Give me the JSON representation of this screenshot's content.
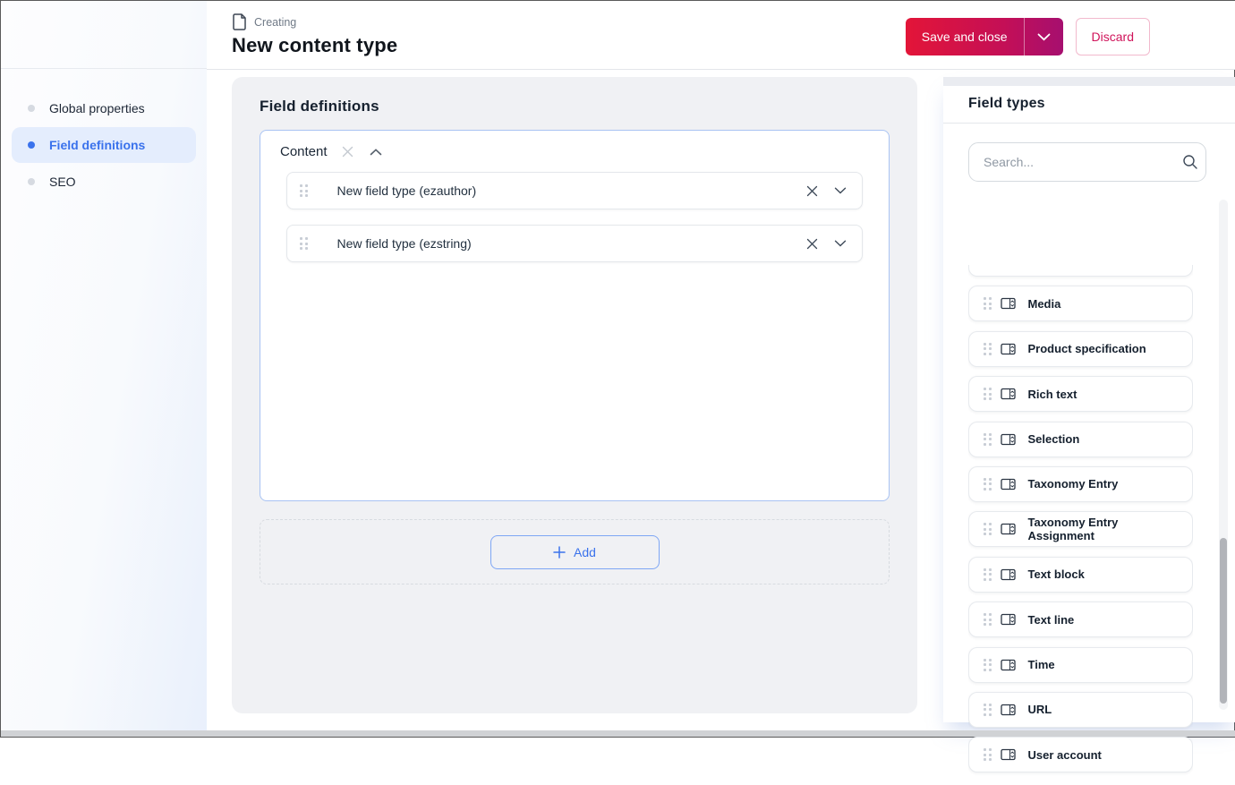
{
  "page": {
    "overline": "Creating",
    "title": "New content type"
  },
  "header": {
    "save_button_label": "Save and close",
    "discard_button_label": "Discard"
  },
  "sidebar": {
    "items": [
      {
        "label": "Global properties",
        "active": false
      },
      {
        "label": "Field definitions",
        "active": true
      },
      {
        "label": "SEO",
        "active": false
      }
    ]
  },
  "main": {
    "section_title": "Field definitions",
    "group": {
      "title": "Content",
      "fields": [
        {
          "label": "New field type (ezauthor)"
        },
        {
          "label": "New field type (ezstring)"
        }
      ]
    },
    "add_button_label": "Add"
  },
  "field_types_panel": {
    "title": "Field types",
    "search_placeholder": "Search...",
    "items": [
      "Media",
      "Product specification",
      "Rich text",
      "Selection",
      "Taxonomy Entry",
      "Taxonomy Entry Assignment",
      "Text block",
      "Text line",
      "Time",
      "URL",
      "User account"
    ]
  },
  "icons": {
    "document-icon": "page outline with folded corner",
    "chevron-down-icon": "⌄",
    "chevron-up-icon": "⌃",
    "close-icon": "✕",
    "search-icon": "🔍",
    "drag-handle-icon": "⠿ six-dot grip",
    "field-input-icon": "input box with stepper",
    "bullet-icon": "•"
  },
  "colors": {
    "accent_blue": "#3a72ec",
    "active_nav_bg": "#e4edfd",
    "primary_gradient_start": "#e31538",
    "primary_gradient_end": "#a60f6f",
    "discard_text": "#d0135a",
    "panel_gray": "#f0f1f4",
    "group_border_blue": "#a9c3f3",
    "heading_navy": "#15202e"
  }
}
